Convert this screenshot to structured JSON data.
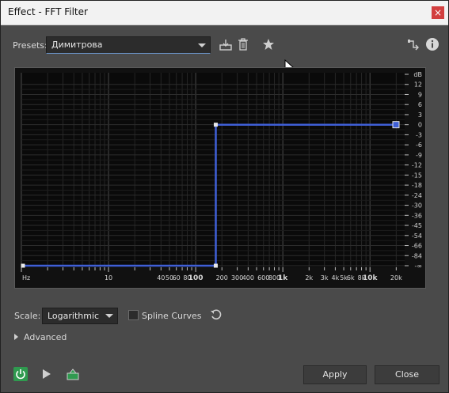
{
  "window": {
    "title": "Effect - FFT Filter",
    "close_label": "×"
  },
  "presets": {
    "label": "Presets:",
    "selected": "Димитрова"
  },
  "toolbar_icons": [
    "save-preset-icon",
    "delete-preset-icon",
    "favorite-star-icon",
    "routing-icon",
    "info-icon"
  ],
  "graph": {
    "freq_ticks": [
      "Hz",
      "10",
      "40",
      "50",
      "60",
      "80",
      "100",
      "200",
      "300",
      "400",
      "600",
      "800",
      "1k",
      "2k",
      "3k",
      "4k",
      "5k",
      "6k",
      "8k",
      "10k",
      "20k"
    ],
    "db_ticks": [
      "dB",
      "12",
      "9",
      "6",
      "3",
      "0",
      "-3",
      "-6",
      "-9",
      "-12",
      "-15",
      "-18",
      "-24",
      "-30",
      "-36",
      "-45",
      "-54",
      "-66",
      "-84",
      "-∞"
    ],
    "curve": [
      {
        "freq_hz": 1,
        "gain_db": "-∞"
      },
      {
        "freq_hz": 170,
        "gain_db": "-∞"
      },
      {
        "freq_hz": 170,
        "gain_db": 0
      },
      {
        "freq_hz": 22000,
        "gain_db": 0
      }
    ],
    "curve_color": "#3f5fd6"
  },
  "scale": {
    "label": "Scale:",
    "selected": "Logarithmic"
  },
  "spline": {
    "label": "Spline Curves",
    "checked": false
  },
  "advanced": {
    "label": "Advanced"
  },
  "buttons": {
    "apply": "Apply",
    "close": "Close"
  }
}
